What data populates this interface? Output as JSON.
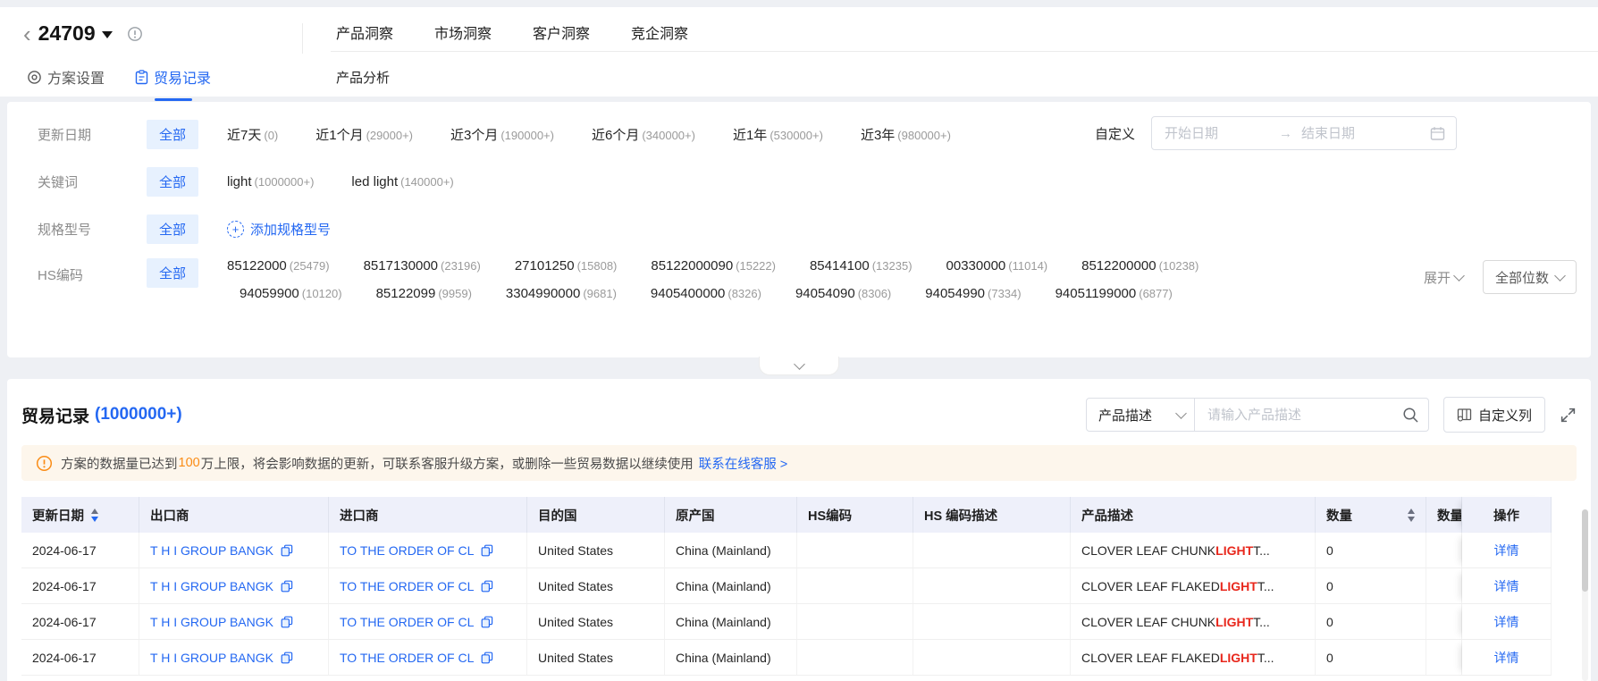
{
  "colors": {
    "accent": "#2468f2",
    "warning_orange": "#fa8c16",
    "highlight_red": "#e8271c",
    "notice_bg": "#fdf6ec",
    "table_header_bg": "#eef0fa"
  },
  "topbar": {
    "back_icon": "‹",
    "title": "24709",
    "left_tabs": [
      {
        "label": "方案设置"
      },
      {
        "label": "贸易记录"
      }
    ],
    "main_tabs": [
      {
        "label": "产品洞察"
      },
      {
        "label": "市场洞察"
      },
      {
        "label": "客户洞察"
      },
      {
        "label": "竞企洞察"
      }
    ],
    "sub_tab": "产品分析"
  },
  "filters": {
    "update": {
      "label": "更新日期",
      "all": "全部",
      "options": [
        {
          "text": "近7天",
          "count": "(0)"
        },
        {
          "text": "近1个月",
          "count": "(29000+)"
        },
        {
          "text": "近3个月",
          "count": "(190000+)"
        },
        {
          "text": "近6个月",
          "count": "(340000+)"
        },
        {
          "text": "近1年",
          "count": "(530000+)"
        },
        {
          "text": "近3年",
          "count": "(980000+)"
        }
      ],
      "custom": "自定义",
      "start_placeholder": "开始日期",
      "arrow": "→",
      "end_placeholder": "结束日期"
    },
    "keyword": {
      "label": "关键词",
      "all": "全部",
      "options": [
        {
          "text": "light",
          "count": "(1000000+)"
        },
        {
          "text": "led light",
          "count": "(140000+)"
        }
      ]
    },
    "spec": {
      "label": "规格型号",
      "all": "全部",
      "add": "添加规格型号"
    },
    "hs": {
      "label": "HS编码",
      "all": "全部",
      "row1": [
        {
          "text": "85122000",
          "count": "(25479)"
        },
        {
          "text": "8517130000",
          "count": "(23196)"
        },
        {
          "text": "27101250",
          "count": "(15808)"
        },
        {
          "text": "85122000090",
          "count": "(15222)"
        },
        {
          "text": "85414100",
          "count": "(13235)"
        },
        {
          "text": "00330000",
          "count": "(11014)"
        },
        {
          "text": "8512200000",
          "count": "(10238)"
        }
      ],
      "row2": [
        {
          "text": "94059900",
          "count": "(10120)"
        },
        {
          "text": "85122099",
          "count": "(9959)"
        },
        {
          "text": "3304990000",
          "count": "(9681)"
        },
        {
          "text": "9405400000",
          "count": "(8326)"
        },
        {
          "text": "94054090",
          "count": "(8306)"
        },
        {
          "text": "94054990",
          "count": "(7334)"
        },
        {
          "text": "94051199000",
          "count": "(6877)"
        }
      ],
      "expand": "展开",
      "digits": "全部位数"
    }
  },
  "records": {
    "title": "贸易记录",
    "count": "(1000000+)",
    "search_field": "产品描述",
    "search_placeholder": "请输入产品描述",
    "customize": "自定义列",
    "notice": {
      "pre": "方案的数据量已达到",
      "highlight": "100",
      "post": "万上限，将会影响数据的更新，可联系客服升级方案，或删除一些贸易数据以继续使用",
      "link": "联系在线客服 >"
    }
  },
  "table": {
    "columns": [
      "更新日期",
      "出口商",
      "进口商",
      "目的国",
      "原产国",
      "HS编码",
      "HS 编码描述",
      "产品描述",
      "数量",
      "数量",
      "操作"
    ],
    "rows": [
      {
        "date": "2024-06-17",
        "exporter": "T H I GROUP BANGK",
        "importer": "TO THE ORDER OF CL",
        "destination": "United States",
        "origin": "China (Mainland)",
        "hs_code": "",
        "hs_desc": "",
        "product_pre": "CLOVER LEAF CHUNK ",
        "product_hl": "LIGHT",
        "product_post": " T...",
        "qty": "0",
        "action": "详情"
      },
      {
        "date": "2024-06-17",
        "exporter": "T H I GROUP BANGK",
        "importer": "TO THE ORDER OF CL",
        "destination": "United States",
        "origin": "China (Mainland)",
        "hs_code": "",
        "hs_desc": "",
        "product_pre": "CLOVER LEAF FLAKED ",
        "product_hl": "LIGHT",
        "product_post": " T...",
        "qty": "0",
        "action": "详情"
      },
      {
        "date": "2024-06-17",
        "exporter": "T H I GROUP BANGK",
        "importer": "TO THE ORDER OF CL",
        "destination": "United States",
        "origin": "China (Mainland)",
        "hs_code": "",
        "hs_desc": "",
        "product_pre": "CLOVER LEAF CHUNK ",
        "product_hl": "LIGHT",
        "product_post": " T...",
        "qty": "0",
        "action": "详情"
      },
      {
        "date": "2024-06-17",
        "exporter": "T H I GROUP BANGK",
        "importer": "TO THE ORDER OF CL",
        "destination": "United States",
        "origin": "China (Mainland)",
        "hs_code": "",
        "hs_desc": "",
        "product_pre": "CLOVER LEAF FLAKED ",
        "product_hl": "LIGHT",
        "product_post": " T...",
        "qty": "0",
        "action": "详情"
      }
    ]
  }
}
